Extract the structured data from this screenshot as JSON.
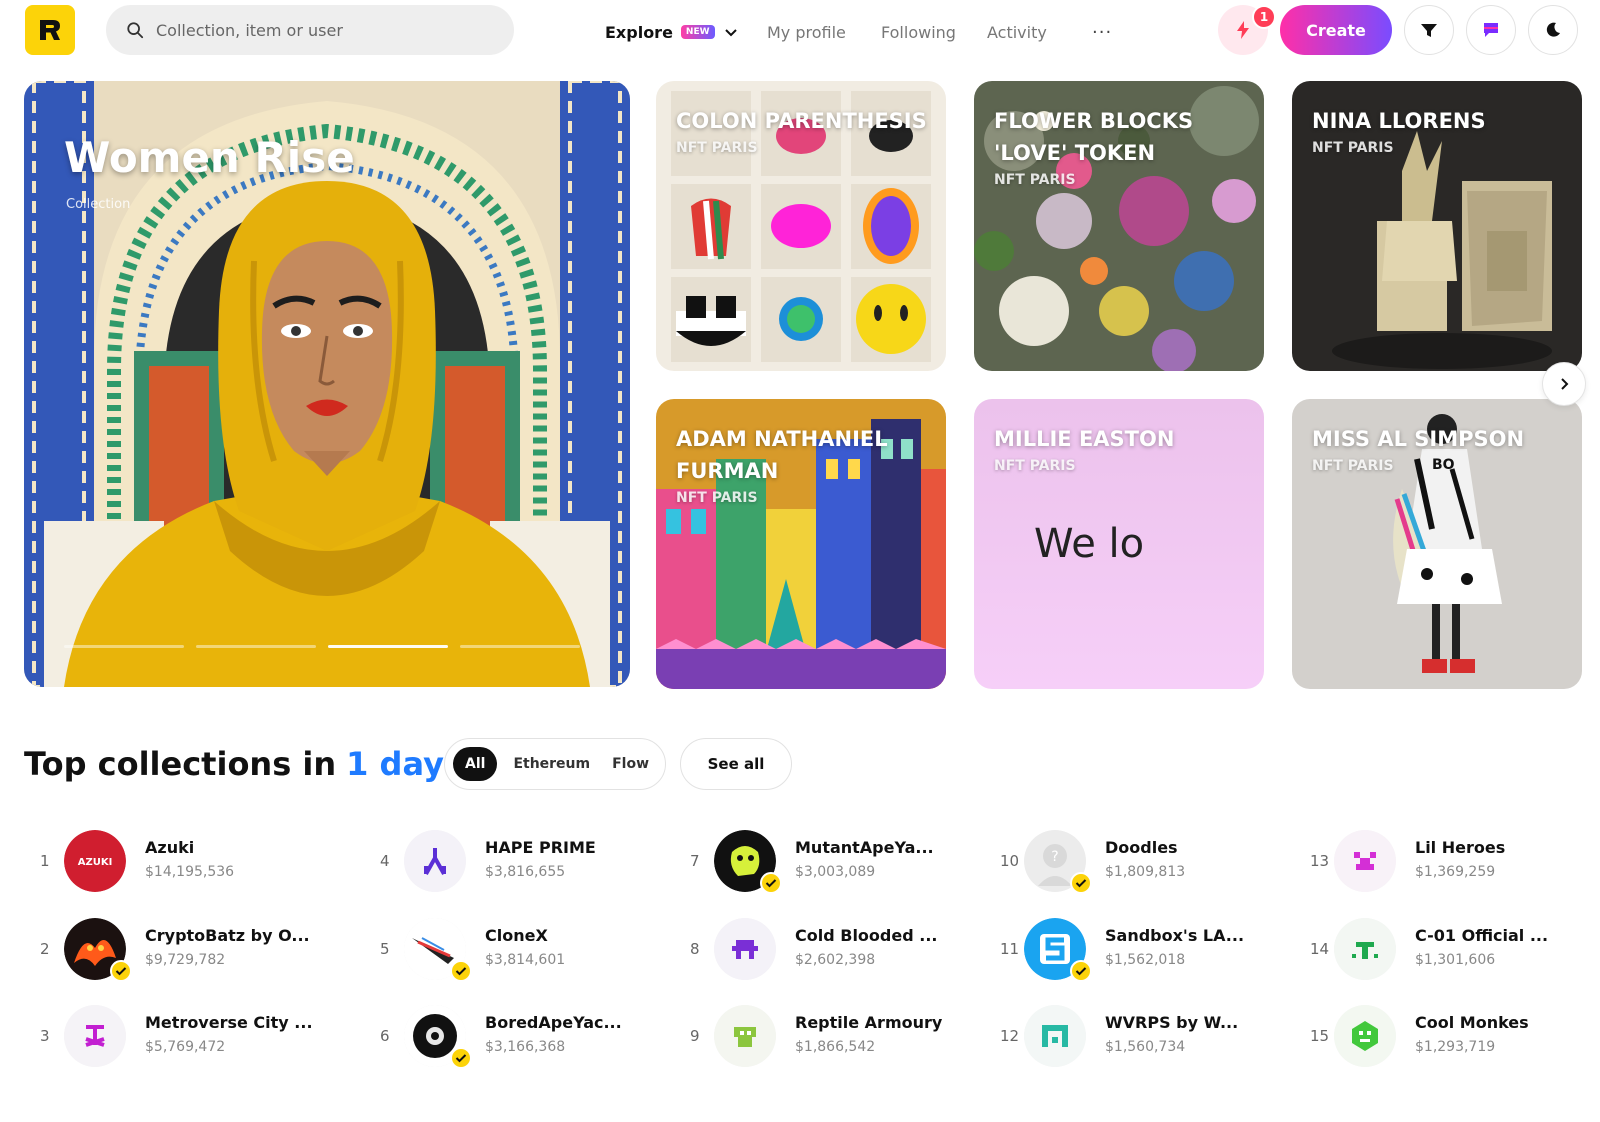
{
  "header": {
    "search_placeholder": "Collection, item or user",
    "nav": {
      "explore": "Explore",
      "explore_badge": "NEW",
      "my_profile": "My profile",
      "following": "Following",
      "activity": "Activity",
      "more": "···"
    },
    "notification_count": "1",
    "create_label": "Create"
  },
  "hero": {
    "title": "Women Rise",
    "subtitle": "Collection",
    "slides": 4,
    "active_slide": 3
  },
  "cards": [
    {
      "title": "COLON PARENTHESIS",
      "subtitle": "NFT Paris"
    },
    {
      "title": "FLOWER BLOCKS 'LOVE' TOKEN",
      "subtitle": "NFT Paris"
    },
    {
      "title": "NINA LLORENS",
      "subtitle": "NFT Paris"
    },
    {
      "title": "ADAM NATHANIEL FURMAN",
      "subtitle": "NFT Paris"
    },
    {
      "title": "MILLIE EASTON",
      "subtitle": "NFT Paris",
      "text": "We lo"
    },
    {
      "title": "MISS AL SIMPSON",
      "subtitle": "NFT Paris"
    }
  ],
  "top_collections": {
    "title": "Top collections in",
    "period": "1 day",
    "filters": [
      "All",
      "Ethereum",
      "Flow"
    ],
    "active_filter": "All",
    "see_all": "See all",
    "items": [
      {
        "rank": "1",
        "name": "Azuki",
        "price": "$14,195,536",
        "verified": false
      },
      {
        "rank": "2",
        "name": "CryptoBatz by O...",
        "price": "$9,729,782",
        "verified": true
      },
      {
        "rank": "3",
        "name": "Metroverse City ...",
        "price": "$5,769,472",
        "verified": false
      },
      {
        "rank": "4",
        "name": "HAPE PRIME",
        "price": "$3,816,655",
        "verified": false
      },
      {
        "rank": "5",
        "name": "CloneX",
        "price": "$3,814,601",
        "verified": true
      },
      {
        "rank": "6",
        "name": "BoredApeYac...",
        "price": "$3,166,368",
        "verified": true
      },
      {
        "rank": "7",
        "name": "MutantApeYa...",
        "price": "$3,003,089",
        "verified": true
      },
      {
        "rank": "8",
        "name": "Cold Blooded ...",
        "price": "$2,602,398",
        "verified": false
      },
      {
        "rank": "9",
        "name": "Reptile Armoury",
        "price": "$1,866,542",
        "verified": false
      },
      {
        "rank": "10",
        "name": "Doodles",
        "price": "$1,809,813",
        "verified": true
      },
      {
        "rank": "11",
        "name": "Sandbox's LA...",
        "price": "$1,562,018",
        "verified": true
      },
      {
        "rank": "12",
        "name": "WVRPS by W...",
        "price": "$1,560,734",
        "verified": false
      },
      {
        "rank": "13",
        "name": "Lil Heroes",
        "price": "$1,369,259",
        "verified": false
      },
      {
        "rank": "14",
        "name": "C-01 Official ...",
        "price": "$1,301,606",
        "verified": false
      },
      {
        "rank": "15",
        "name": "Cool Monkes",
        "price": "$1,293,719",
        "verified": false
      }
    ],
    "azuki_logo_text": "AZUKI"
  },
  "colors": {
    "brand_yellow": "#fcd309",
    "accent_blue": "#1f7bff",
    "create_gradient_start": "#ff2fa8",
    "create_gradient_end": "#7a4cff",
    "verified": "#fcd309"
  }
}
